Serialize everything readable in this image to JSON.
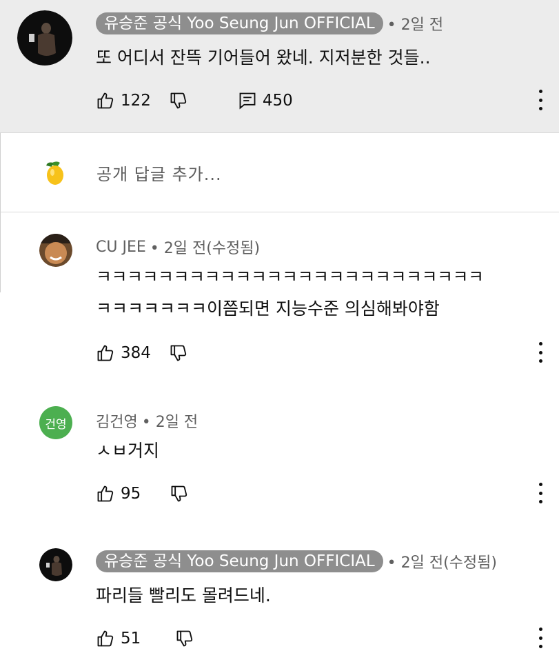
{
  "comments": [
    {
      "author": "유승준 공식 Yoo Seung Jun OFFICIAL",
      "is_owner": true,
      "time": "• 2일 전",
      "lines": [
        "또 어디서 잔뜩 기어들어 왔네. 지저분한 것들.."
      ],
      "likes": "122",
      "replies": "450"
    },
    {
      "author": "CU JEE",
      "is_owner": false,
      "time": "• 2일 전(수정됨)",
      "lines": [
        "ㅋㅋㅋㅋㅋㅋㅋㅋㅋㅋㅋㅋㅋㅋㅋㅋㅋㅋㅋㅋㅋㅋㅋㅋㅋ",
        "ㅋㅋㅋㅋㅋㅋㅋ이쯤되면 지능수준 의심해봐야함"
      ],
      "likes": "384"
    },
    {
      "author": "김건영",
      "avatar_text": "건영",
      "is_owner": false,
      "time": "• 2일 전",
      "lines": [
        "ㅅㅂ거지"
      ],
      "likes": "95"
    },
    {
      "author": "유승준 공식 Yoo Seung Jun OFFICIAL",
      "is_owner": true,
      "time": "• 2일 전(수정됨)",
      "lines": [
        "파리들 빨리도 몰려드네."
      ],
      "likes": "51"
    }
  ],
  "reply_box": {
    "placeholder": "공개 답글 추가..."
  },
  "icons": {
    "like": "thumb-up-icon",
    "dislike": "thumb-down-icon",
    "reply": "comment-icon",
    "more": "more-vertical-icon",
    "user_avatar": "mango-icon"
  },
  "colors": {
    "owner_badge": "#8e8e8e",
    "top_bg": "#ececec",
    "green_avatar": "#4caf50"
  }
}
